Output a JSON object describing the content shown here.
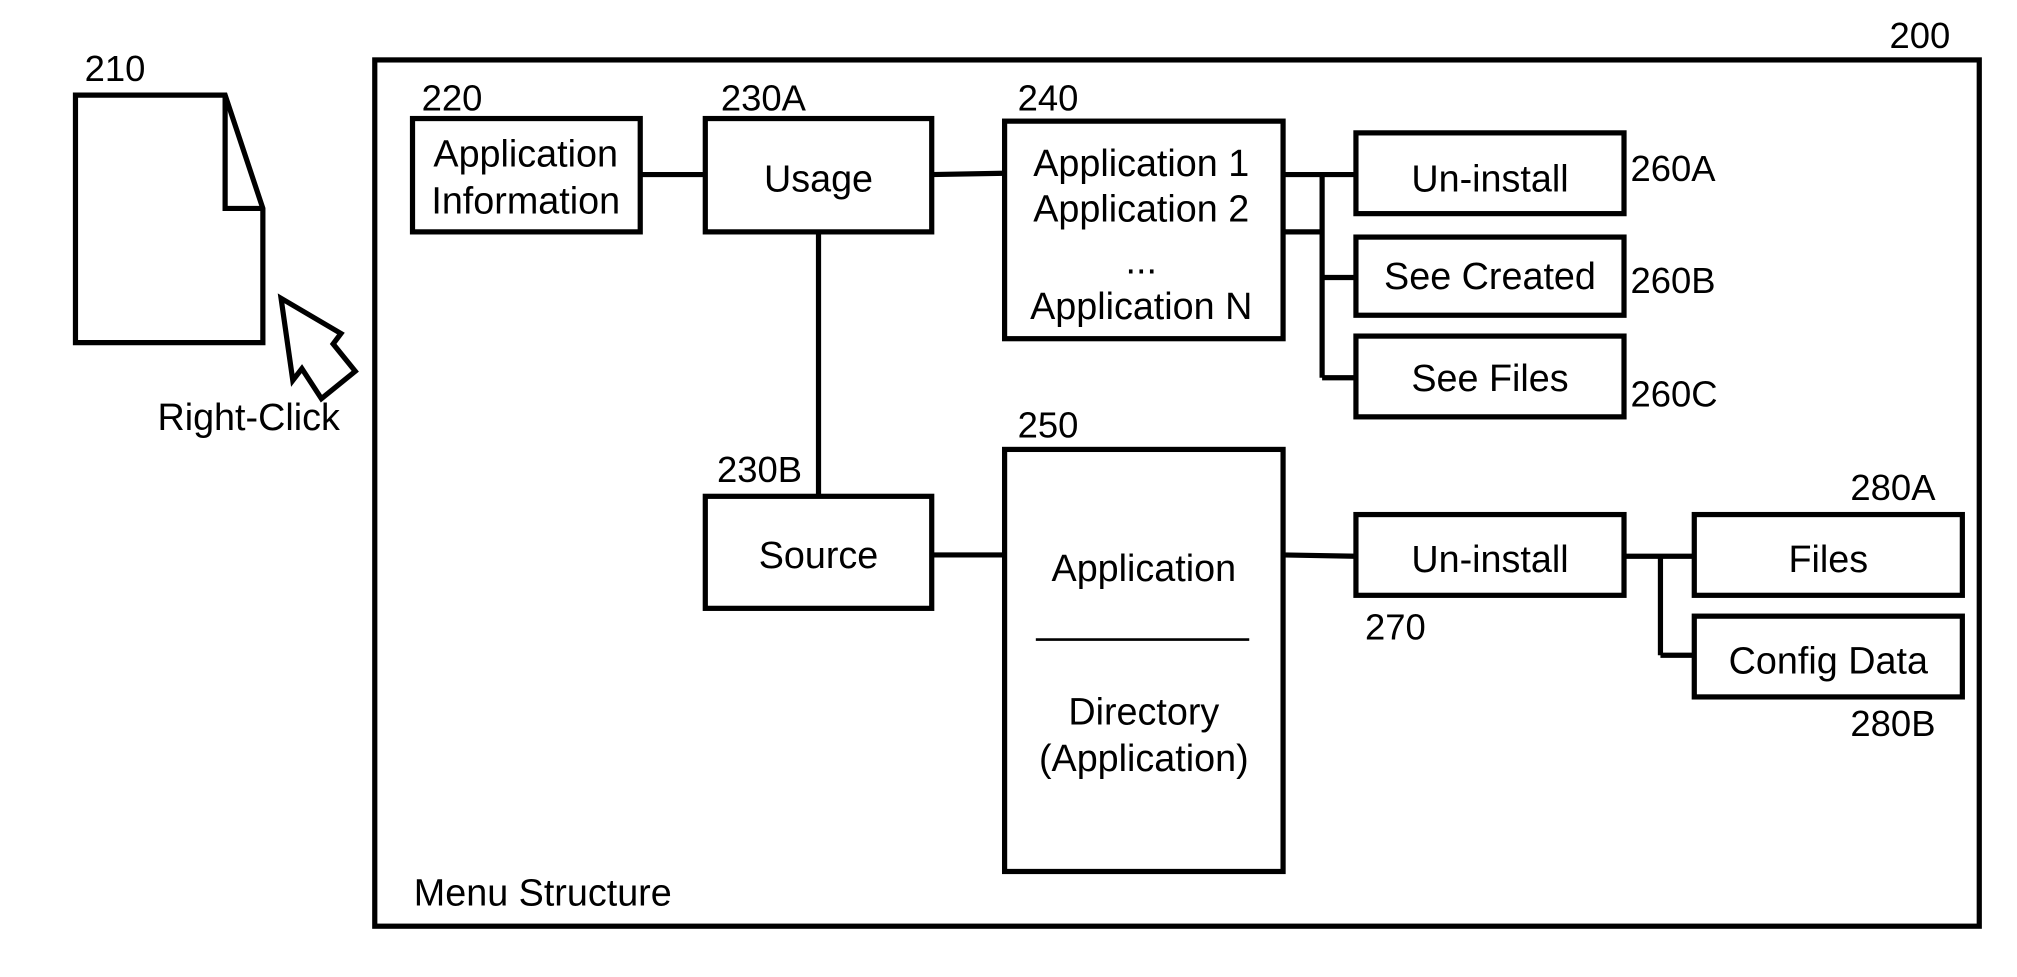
{
  "figure": {
    "container": {
      "ref": "200",
      "caption": "Menu Structure"
    },
    "document": {
      "ref": "210",
      "action_label": "Right-Click"
    },
    "nodes": {
      "app_info": {
        "ref": "220",
        "lines": [
          "Application",
          "Information"
        ]
      },
      "usage": {
        "ref": "230A",
        "label": "Usage"
      },
      "source": {
        "ref": "230B",
        "label": "Source"
      },
      "app_list": {
        "ref": "240",
        "lines": [
          "Application 1",
          "Application 2",
          "...",
          "Application N"
        ]
      },
      "app_dir": {
        "ref": "250",
        "top": "Application",
        "bottom_lines": [
          "Directory",
          "(Application)"
        ]
      },
      "uninstall_a": {
        "ref": "260A",
        "label": "Un-install"
      },
      "see_created": {
        "ref": "260B",
        "label": "See Created"
      },
      "see_files": {
        "ref": "260C",
        "label": "See Files"
      },
      "uninstall_270": {
        "ref": "270",
        "label": "Un-install"
      },
      "files": {
        "ref": "280A",
        "label": "Files"
      },
      "config_data": {
        "ref": "280B",
        "label": "Config Data"
      }
    }
  }
}
